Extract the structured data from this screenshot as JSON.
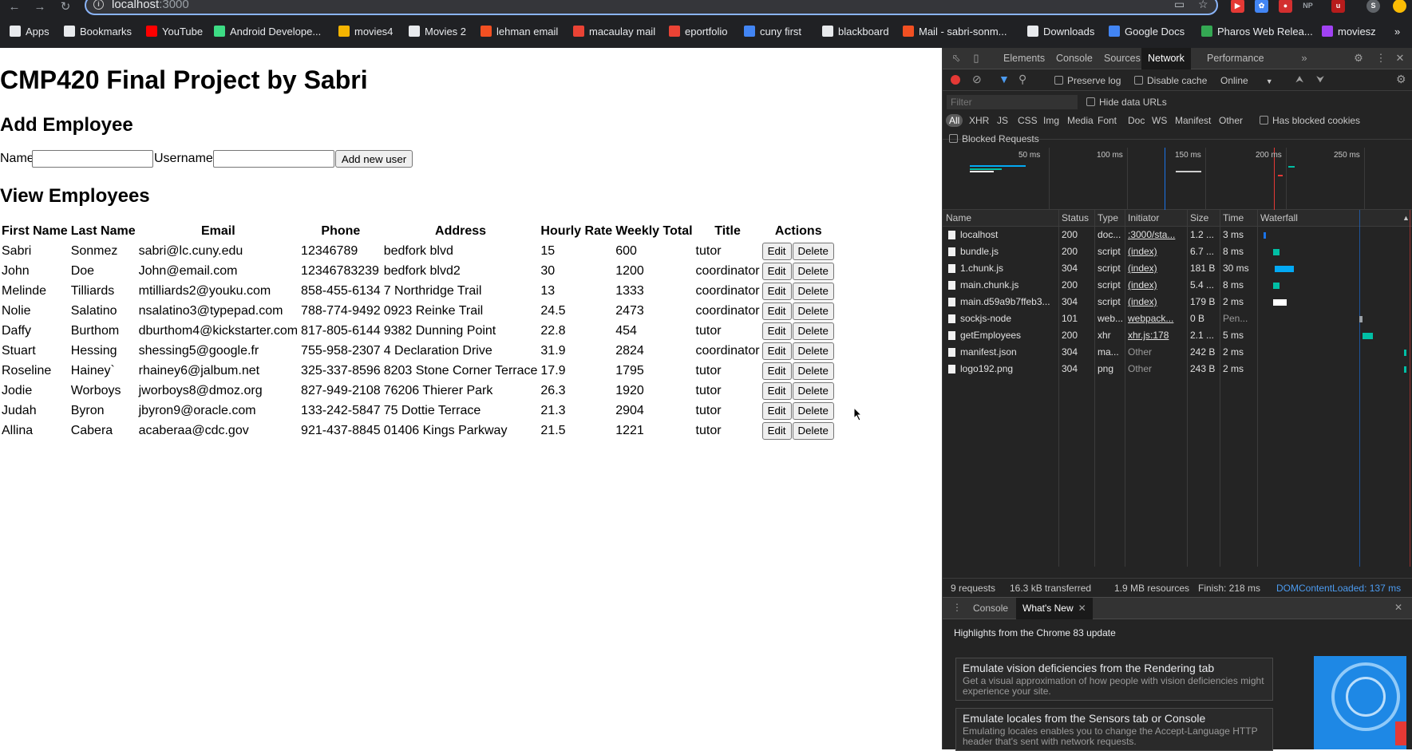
{
  "browser": {
    "url_host": "localhost",
    "url_port": ":3000",
    "bookmarks": [
      {
        "label": "Apps",
        "icon": "apps-grid-icon",
        "color": "#e8eaed"
      },
      {
        "label": "Bookmarks",
        "icon": "star-icon",
        "color": "#e8eaed"
      },
      {
        "label": "YouTube",
        "icon": "youtube-icon",
        "color": "#ff0000"
      },
      {
        "label": "Android Develope...",
        "icon": "android-icon",
        "color": "#3ddc84"
      },
      {
        "label": "movies4",
        "icon": "movies-icon",
        "color": "#f4b400"
      },
      {
        "label": "Movies 2",
        "icon": "globe-icon",
        "color": "#e8eaed"
      },
      {
        "label": "lehman email",
        "icon": "microsoft-icon",
        "color": "#f25022"
      },
      {
        "label": "macaulay mail",
        "icon": "gmail-icon",
        "color": "#ea4335"
      },
      {
        "label": "eportfolio",
        "icon": "m-icon",
        "color": "#ea4335"
      },
      {
        "label": "cuny first",
        "icon": "doc-icon",
        "color": "#4285f4"
      },
      {
        "label": "blackboard",
        "icon": "blackboard-icon",
        "color": "#e8eaed"
      },
      {
        "label": "Mail - sabri-sonm...",
        "icon": "microsoft-icon",
        "color": "#f25022"
      },
      {
        "label": "Downloads",
        "icon": "download-icon",
        "color": "#e8eaed"
      },
      {
        "label": "Google Docs",
        "icon": "docs-icon",
        "color": "#4285f4"
      },
      {
        "label": "Pharos Web Relea...",
        "icon": "pharos-icon",
        "color": "#34a853"
      },
      {
        "label": "moviesz",
        "icon": "moviesz-icon",
        "color": "#a142f4"
      }
    ]
  },
  "page": {
    "title": "CMP420 Final Project by Sabri",
    "add_heading": "Add Employee",
    "name_label": "Name",
    "username_label": "Username",
    "name_value": "",
    "username_value": "",
    "add_button": "Add new user",
    "view_heading": "View Employees",
    "columns": [
      "First Name",
      "Last Name",
      "Email",
      "Phone",
      "Address",
      "Hourly Rate",
      "Weekly Total",
      "Title",
      "Actions"
    ],
    "edit_label": "Edit",
    "delete_label": "Delete",
    "rows": [
      [
        "Sabri",
        "Sonmez",
        "sabri@lc.cuny.edu",
        "12346789",
        "bedfork blvd",
        "15",
        "600",
        "tutor"
      ],
      [
        "John",
        "Doe",
        "John@email.com",
        "12346783239",
        "bedfork blvd2",
        "30",
        "1200",
        "coordinator"
      ],
      [
        "Melinde",
        "Tilliards",
        "mtilliards2@youku.com",
        "858-455-6134",
        "7 Northridge Trail",
        "13",
        "1333",
        "coordinator"
      ],
      [
        "Nolie",
        "Salatino",
        "nsalatino3@typepad.com",
        "788-774-9492",
        "0923 Reinke Trail",
        "24.5",
        "2473",
        "coordinator"
      ],
      [
        "Daffy",
        "Burthom",
        "dburthom4@kickstarter.com",
        "817-805-6144",
        "9382 Dunning Point",
        "22.8",
        "454",
        "tutor"
      ],
      [
        "Stuart",
        "Hessing",
        "shessing5@google.fr",
        "755-958-2307",
        "4 Declaration Drive",
        "31.9",
        "2824",
        "coordinator"
      ],
      [
        "Roseline",
        "Hainey`",
        "rhainey6@jalbum.net",
        "325-337-8596",
        "8203 Stone Corner Terrace",
        "17.9",
        "1795",
        "tutor"
      ],
      [
        "Jodie",
        "Worboys",
        "jworboys8@dmoz.org",
        "827-949-2108",
        "76206 Thierer Park",
        "26.3",
        "1920",
        "tutor"
      ],
      [
        "Judah",
        "Byron",
        "jbyron9@oracle.com",
        "133-242-5847",
        "75 Dottie Terrace",
        "21.3",
        "2904",
        "tutor"
      ],
      [
        "Allina",
        "Cabera",
        "acaberaa@cdc.gov",
        "921-437-8845",
        "01406 Kings Parkway",
        "21.5",
        "1221",
        "tutor"
      ]
    ]
  },
  "devtools": {
    "tabs": [
      "Elements",
      "Console",
      "Sources",
      "Network",
      "Performance"
    ],
    "active_tab": "Network",
    "preserve_log": "Preserve log",
    "disable_cache": "Disable cache",
    "throttle": "Online",
    "filter_placeholder": "Filter",
    "hide_data_urls": "Hide data URLs",
    "filter_types": [
      "All",
      "XHR",
      "JS",
      "CSS",
      "Img",
      "Media",
      "Font",
      "Doc",
      "WS",
      "Manifest",
      "Other"
    ],
    "has_blocked_cookies": "Has blocked cookies",
    "blocked_requests": "Blocked Requests",
    "timeline_ticks": [
      "50 ms",
      "100 ms",
      "150 ms",
      "200 ms",
      "250 ms"
    ],
    "columns": [
      "Name",
      "Status",
      "Type",
      "Initiator",
      "Size",
      "Time",
      "Waterfall"
    ],
    "requests": [
      {
        "name": "localhost",
        "status": "200",
        "type": "doc...",
        "initiator": ":3000/sta...",
        "size": "1.2 ...",
        "time": "3 ms",
        "wf_start": 0.01,
        "wf_len": 0.02,
        "wf_color": "#1a73e8"
      },
      {
        "name": "bundle.js",
        "status": "200",
        "type": "script",
        "initiator": "(index)",
        "size": "6.7 ...",
        "time": "8 ms",
        "wf_start": 0.08,
        "wf_len": 0.04,
        "wf_color": "#00bfa5"
      },
      {
        "name": "1.chunk.js",
        "status": "304",
        "type": "script",
        "initiator": "(index)",
        "size": "181 B",
        "time": "30 ms",
        "wf_start": 0.09,
        "wf_len": 0.13,
        "wf_color": "#03a9f4"
      },
      {
        "name": "main.chunk.js",
        "status": "200",
        "type": "script",
        "initiator": "(index)",
        "size": "5.4 ...",
        "time": "8 ms",
        "wf_start": 0.08,
        "wf_len": 0.04,
        "wf_color": "#00bfa5"
      },
      {
        "name": "main.d59a9b7ffeb3...",
        "status": "304",
        "type": "script",
        "initiator": "(index)",
        "size": "179 B",
        "time": "2 ms",
        "wf_start": 0.08,
        "wf_len": 0.09,
        "wf_color": "#ffffff"
      },
      {
        "name": "sockjs-node",
        "status": "101",
        "type": "web...",
        "initiator": "webpack...",
        "size": "0 B",
        "time": "Pen...",
        "wf_start": 0.68,
        "wf_len": 0.02,
        "wf_color": "#9aa0a6"
      },
      {
        "name": "getEmployees",
        "status": "200",
        "type": "xhr",
        "initiator": "xhr.js:178",
        "size": "2.1 ...",
        "time": "5 ms",
        "wf_start": 0.7,
        "wf_len": 0.07,
        "wf_color": "#00bfa5"
      },
      {
        "name": "manifest.json",
        "status": "304",
        "type": "ma...",
        "initiator": "Other",
        "size": "242 B",
        "time": "2 ms",
        "wf_start": 0.99,
        "wf_len": 0.01,
        "wf_color": "#00bfa5"
      },
      {
        "name": "logo192.png",
        "status": "304",
        "type": "png",
        "initiator": "Other",
        "size": "243 B",
        "time": "2 ms",
        "wf_start": 0.99,
        "wf_len": 0.0,
        "wf_color": "#00bfa5"
      }
    ],
    "summary_requests": "9 requests",
    "summary_transferred": "16.3 kB transferred",
    "summary_resources": "1.9 MB resources",
    "summary_finish": "Finish: 218 ms",
    "summary_dcl": "DOMContentLoaded: 137 ms",
    "drawer_tabs": [
      "Console",
      "What's New"
    ],
    "drawer_headline": "Highlights from the Chrome 83 update",
    "cards": [
      {
        "title": "Emulate vision deficiencies from the Rendering tab",
        "desc": "Get a visual approximation of how people with vision deficiencies might experience your site."
      },
      {
        "title": "Emulate locales from the Sensors tab or Console",
        "desc": "Emulating locales enables you to change the Accept-Language HTTP header that's sent with network requests."
      }
    ]
  }
}
